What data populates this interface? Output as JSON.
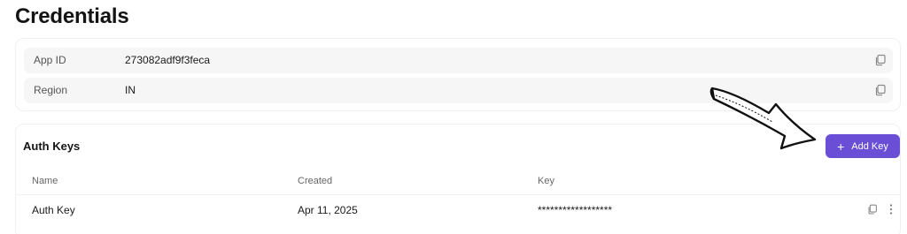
{
  "page": {
    "title": "Credentials"
  },
  "credentials": {
    "rows": [
      {
        "label": "App ID",
        "value": "273082adf9f3feca",
        "icon": "copy-icon"
      },
      {
        "label": "Region",
        "value": "IN",
        "icon": "copy-icon"
      }
    ]
  },
  "auth_keys": {
    "title": "Auth Keys",
    "add_button": {
      "label": "Add Key",
      "icon": "plus-icon"
    },
    "columns": [
      "Name",
      "Created",
      "Key"
    ],
    "rows": [
      {
        "name": "Auth Key",
        "created": "Apr 11, 2025",
        "key": "******************"
      }
    ]
  },
  "colors": {
    "accent": "#6a4fd6",
    "row_bg": "#f6f6f6"
  }
}
